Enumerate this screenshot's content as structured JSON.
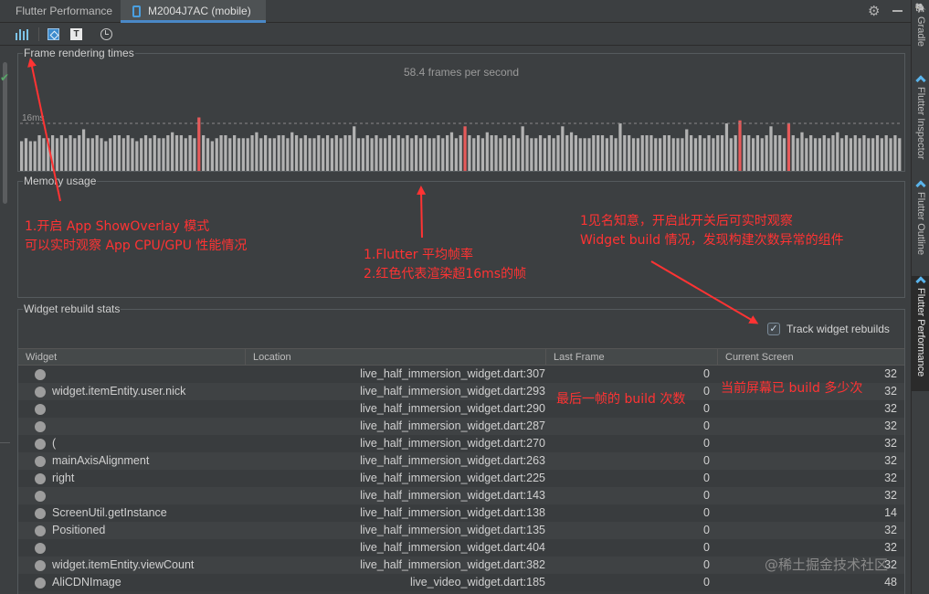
{
  "header": {
    "tab_performance": "Flutter Performance",
    "tab_device": "M2004J7AC (mobile)",
    "device_icon": "phone-icon",
    "settings_icon": "gear-icon",
    "minimize_icon": "minimize-icon"
  },
  "toolbar": {
    "buttons": [
      {
        "name": "performance-overlay",
        "icon": "bar-chart-icon"
      },
      {
        "name": "repaint-rainbow",
        "icon": "repaint-icon"
      },
      {
        "name": "debug-text",
        "icon": "text-icon",
        "glyph": "T"
      },
      {
        "name": "slow-animations",
        "icon": "clock-icon"
      }
    ]
  },
  "side_tabs": {
    "gradle": "Gradle",
    "inspector": "Flutter Inspector",
    "outline": "Flutter Outline",
    "performance": "Flutter Performance"
  },
  "frames": {
    "title": "Frame rendering times",
    "fps_text": "58.4 frames per second",
    "threshold_label": "16ms"
  },
  "chart_data": {
    "type": "bar",
    "title": "Frame rendering times",
    "threshold_ms": 16,
    "threshold_label": "16ms",
    "values": [
      10,
      11,
      10,
      10,
      12,
      11,
      11,
      12,
      11,
      12,
      11,
      12,
      11,
      12,
      14,
      11,
      11,
      12,
      11,
      10,
      11,
      12,
      12,
      11,
      12,
      11,
      10,
      11,
      12,
      11,
      12,
      11,
      11,
      12,
      13,
      12,
      12,
      11,
      12,
      11,
      18,
      12,
      11,
      10,
      11,
      12,
      12,
      11,
      12,
      11,
      11,
      11,
      12,
      13,
      11,
      12,
      11,
      11,
      12,
      12,
      11,
      13,
      12,
      11,
      12,
      11,
      11,
      12,
      11,
      12,
      11,
      12,
      11,
      12,
      12,
      15,
      11,
      11,
      12,
      11,
      12,
      11,
      11,
      12,
      11,
      12,
      11,
      12,
      11,
      12,
      11,
      12,
      11,
      11,
      12,
      11,
      12,
      13,
      11,
      12,
      15,
      12,
      11,
      12,
      11,
      13,
      12,
      12,
      11,
      12,
      11,
      12,
      11,
      15,
      12,
      11,
      11,
      12,
      11,
      12,
      11,
      12,
      15,
      12,
      13,
      12,
      11,
      11,
      11,
      12,
      12,
      12,
      11,
      12,
      11,
      16,
      12,
      12,
      11,
      11,
      12,
      12,
      12,
      11,
      11,
      12,
      12,
      11,
      11,
      11,
      14,
      12,
      11,
      12,
      11,
      12,
      11,
      12,
      12,
      16,
      11,
      12,
      17,
      12,
      12,
      11,
      12,
      11,
      12,
      15,
      12,
      12,
      11,
      16,
      12,
      11,
      13,
      11,
      12,
      11,
      11,
      12,
      11,
      12,
      13,
      11,
      12,
      11,
      12,
      11,
      12,
      11,
      11,
      12,
      11,
      12,
      11,
      12,
      11
    ],
    "red_indices": [
      40,
      100,
      162,
      173
    ],
    "colors": {
      "normal": "#b2b2b2",
      "jank": "#e65a5a",
      "threshold": "#8a8a8a"
    }
  },
  "memory": {
    "title": "Memory usage"
  },
  "rebuild": {
    "title": "Widget rebuild stats",
    "track_label": "Track widget rebuilds",
    "track_checked": "✓",
    "columns": [
      "Widget",
      "Location",
      "Last Frame",
      "Current Screen"
    ],
    "rows": [
      {
        "widget": "",
        "location": "live_half_immersion_widget.dart:307",
        "last": "0",
        "current": "32"
      },
      {
        "widget": "widget.itemEntity.user.nick",
        "location": "live_half_immersion_widget.dart:293",
        "last": "0",
        "current": "32"
      },
      {
        "widget": "",
        "location": "live_half_immersion_widget.dart:290",
        "last": "0",
        "current": "32"
      },
      {
        "widget": "",
        "location": "live_half_immersion_widget.dart:287",
        "last": "0",
        "current": "32"
      },
      {
        "widget": "(",
        "location": "live_half_immersion_widget.dart:270",
        "last": "0",
        "current": "32"
      },
      {
        "widget": "mainAxisAlignment",
        "location": "live_half_immersion_widget.dart:263",
        "last": "0",
        "current": "32"
      },
      {
        "widget": "right",
        "location": "live_half_immersion_widget.dart:225",
        "last": "0",
        "current": "32"
      },
      {
        "widget": "",
        "location": "live_half_immersion_widget.dart:143",
        "last": "0",
        "current": "32"
      },
      {
        "widget": "ScreenUtil.getInstance",
        "location": "live_half_immersion_widget.dart:138",
        "last": "0",
        "current": "14"
      },
      {
        "widget": "Positioned",
        "location": "live_half_immersion_widget.dart:135",
        "last": "0",
        "current": "32"
      },
      {
        "widget": "",
        "location": "live_half_immersion_widget.dart:404",
        "last": "0",
        "current": "32"
      },
      {
        "widget": "widget.itemEntity.viewCount",
        "location": "live_half_immersion_widget.dart:382",
        "last": "0",
        "current": "32"
      },
      {
        "widget": "AliCDNImage",
        "location": "live_video_widget.dart:185",
        "last": "0",
        "current": "48"
      }
    ]
  },
  "annotations": {
    "overlay_line1": "1.开启 App ShowOverlay 模式",
    "overlay_line2": "可以实时观察 App CPU/GPU 性能情况",
    "fps_line1": "1.Flutter 平均帧率",
    "fps_line2": "2.红色代表渲染超16ms的帧",
    "track_line1": "1见名知意，开启此开关后可实时观察",
    "track_line2": "Widget build 情况，发现构建次数异常的组件",
    "last_frame_note": "最后一帧的 build 次数",
    "current_screen_note": "当前屏幕已 build 多少次",
    "color": "#ff3333"
  },
  "watermark": "@稀土掘金技术社区"
}
